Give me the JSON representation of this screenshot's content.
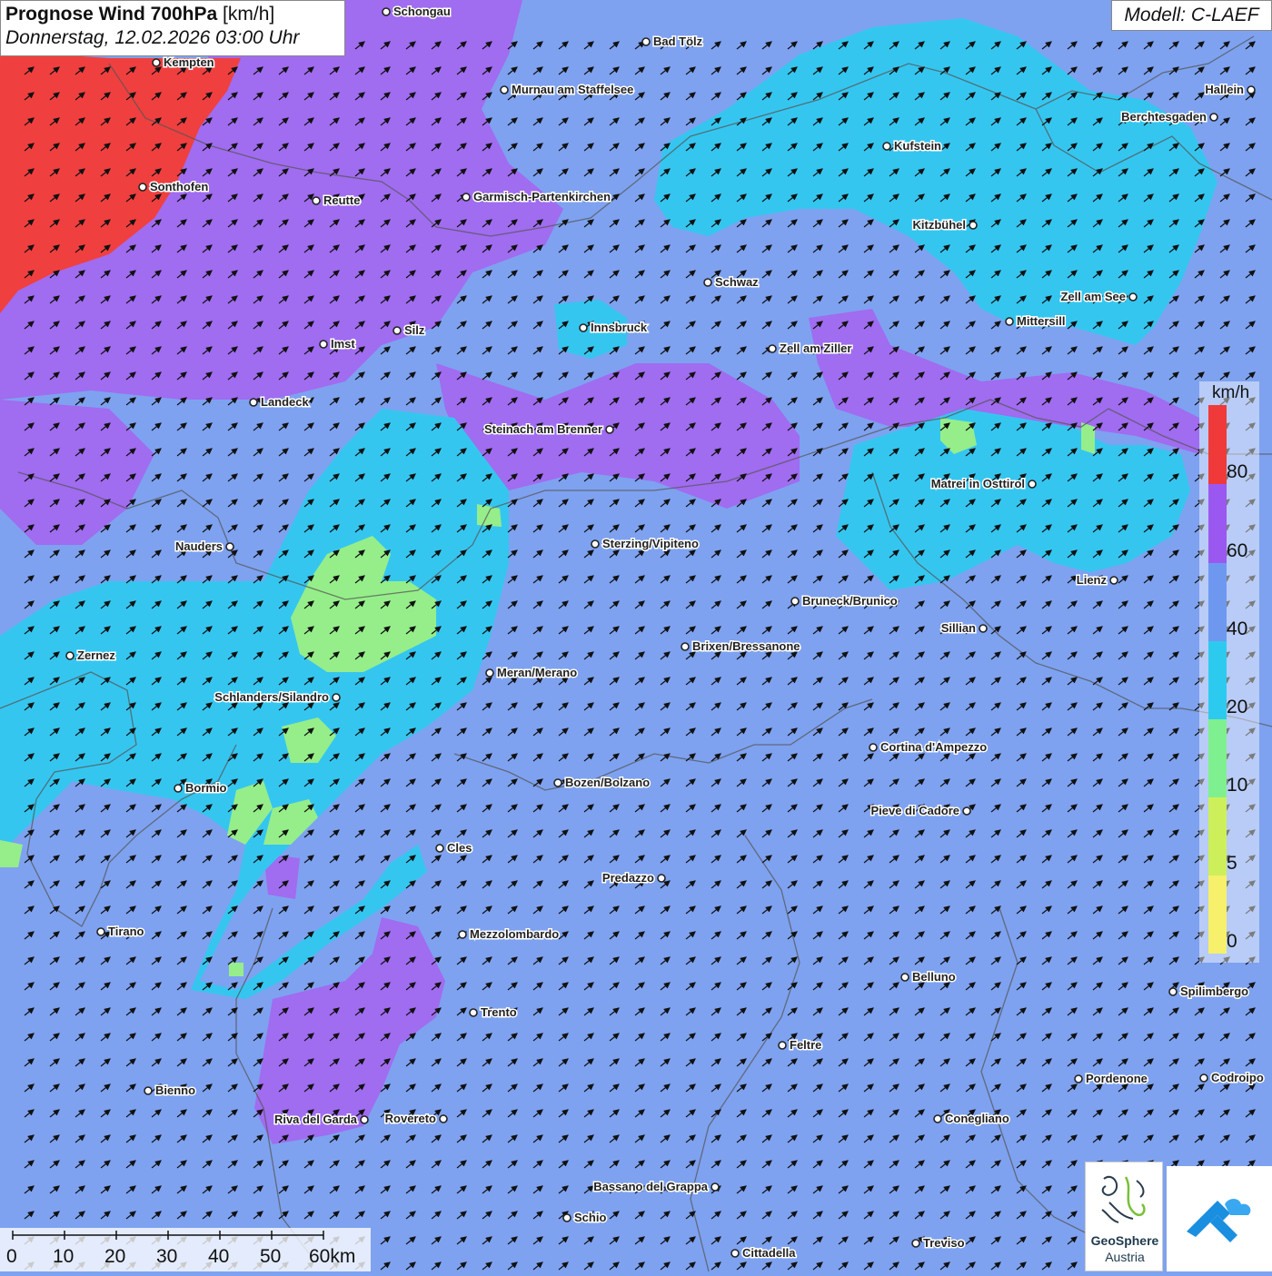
{
  "header": {
    "title": "Prognose Wind 700hPa",
    "unit": "[km/h]",
    "datetime": "Donnerstag, 12.02.2026 03:00 Uhr",
    "model": "Modell: C-LAEF"
  },
  "legend": {
    "unit": "km/h",
    "ticks": [
      "80",
      "60",
      "40",
      "20",
      "10",
      "5",
      "0"
    ],
    "colors": [
      "#f03a3a",
      "#9b58f0",
      "#6e98f0",
      "#2dcaf0",
      "#7ff08f",
      "#cdf05a",
      "#f6f06a"
    ]
  },
  "scale": {
    "labels": [
      "0",
      "10",
      "20",
      "30",
      "40",
      "50",
      "60km"
    ]
  },
  "logos": {
    "geosphere_line1": "GeoSphere",
    "geosphere_line2": "Austria",
    "geosphere_icon": "geosphere-logo-icon",
    "app_icon": "cloud-app-logo-icon"
  },
  "cities": [
    {
      "name": "Schongau"
    },
    {
      "name": "Bad Tölz"
    },
    {
      "name": "Kempten"
    },
    {
      "name": "Murnau am Staffelsee"
    },
    {
      "name": "Hallein"
    },
    {
      "name": "Berchtesgaden"
    },
    {
      "name": "Kufstein"
    },
    {
      "name": "Sonthofen"
    },
    {
      "name": "Reutte"
    },
    {
      "name": "Garmisch-Partenkirchen"
    },
    {
      "name": "Kitzbühel"
    },
    {
      "name": "Schwaz"
    },
    {
      "name": "Zell am See"
    },
    {
      "name": "Mittersill"
    },
    {
      "name": "Innsbruck"
    },
    {
      "name": "Imst"
    },
    {
      "name": "Silz"
    },
    {
      "name": "Zell am Ziller"
    },
    {
      "name": "Landeck"
    },
    {
      "name": "Steinach am Brenner"
    },
    {
      "name": "Matrei in Osttirol"
    },
    {
      "name": "Nauders"
    },
    {
      "name": "Sterzing/Vipiteno"
    },
    {
      "name": "Lienz"
    },
    {
      "name": "Bruneck/Brunico"
    },
    {
      "name": "Sillian"
    },
    {
      "name": "Zernez"
    },
    {
      "name": "Brixen/Bressanone"
    },
    {
      "name": "Meran/Merano"
    },
    {
      "name": "Schlanders/Silandro"
    },
    {
      "name": "Cortina d'Ampezzo"
    },
    {
      "name": "Bozen/Bolzano"
    },
    {
      "name": "Bormio"
    },
    {
      "name": "Pieve di Cadore"
    },
    {
      "name": "Cles"
    },
    {
      "name": "Predazzo"
    },
    {
      "name": "Tirano"
    },
    {
      "name": "Mezzolombardo"
    },
    {
      "name": "Belluno"
    },
    {
      "name": "Spilimbergo"
    },
    {
      "name": "Trento"
    },
    {
      "name": "Feltre"
    },
    {
      "name": "Pordenone"
    },
    {
      "name": "Codroipo"
    },
    {
      "name": "Bienno"
    },
    {
      "name": "Riva del Garda"
    },
    {
      "name": "Rovereto"
    },
    {
      "name": "Conegliano"
    },
    {
      "name": "Bassano del Grappa"
    },
    {
      "name": "Schio"
    },
    {
      "name": "Treviso"
    },
    {
      "name": "Cittadella"
    }
  ]
}
